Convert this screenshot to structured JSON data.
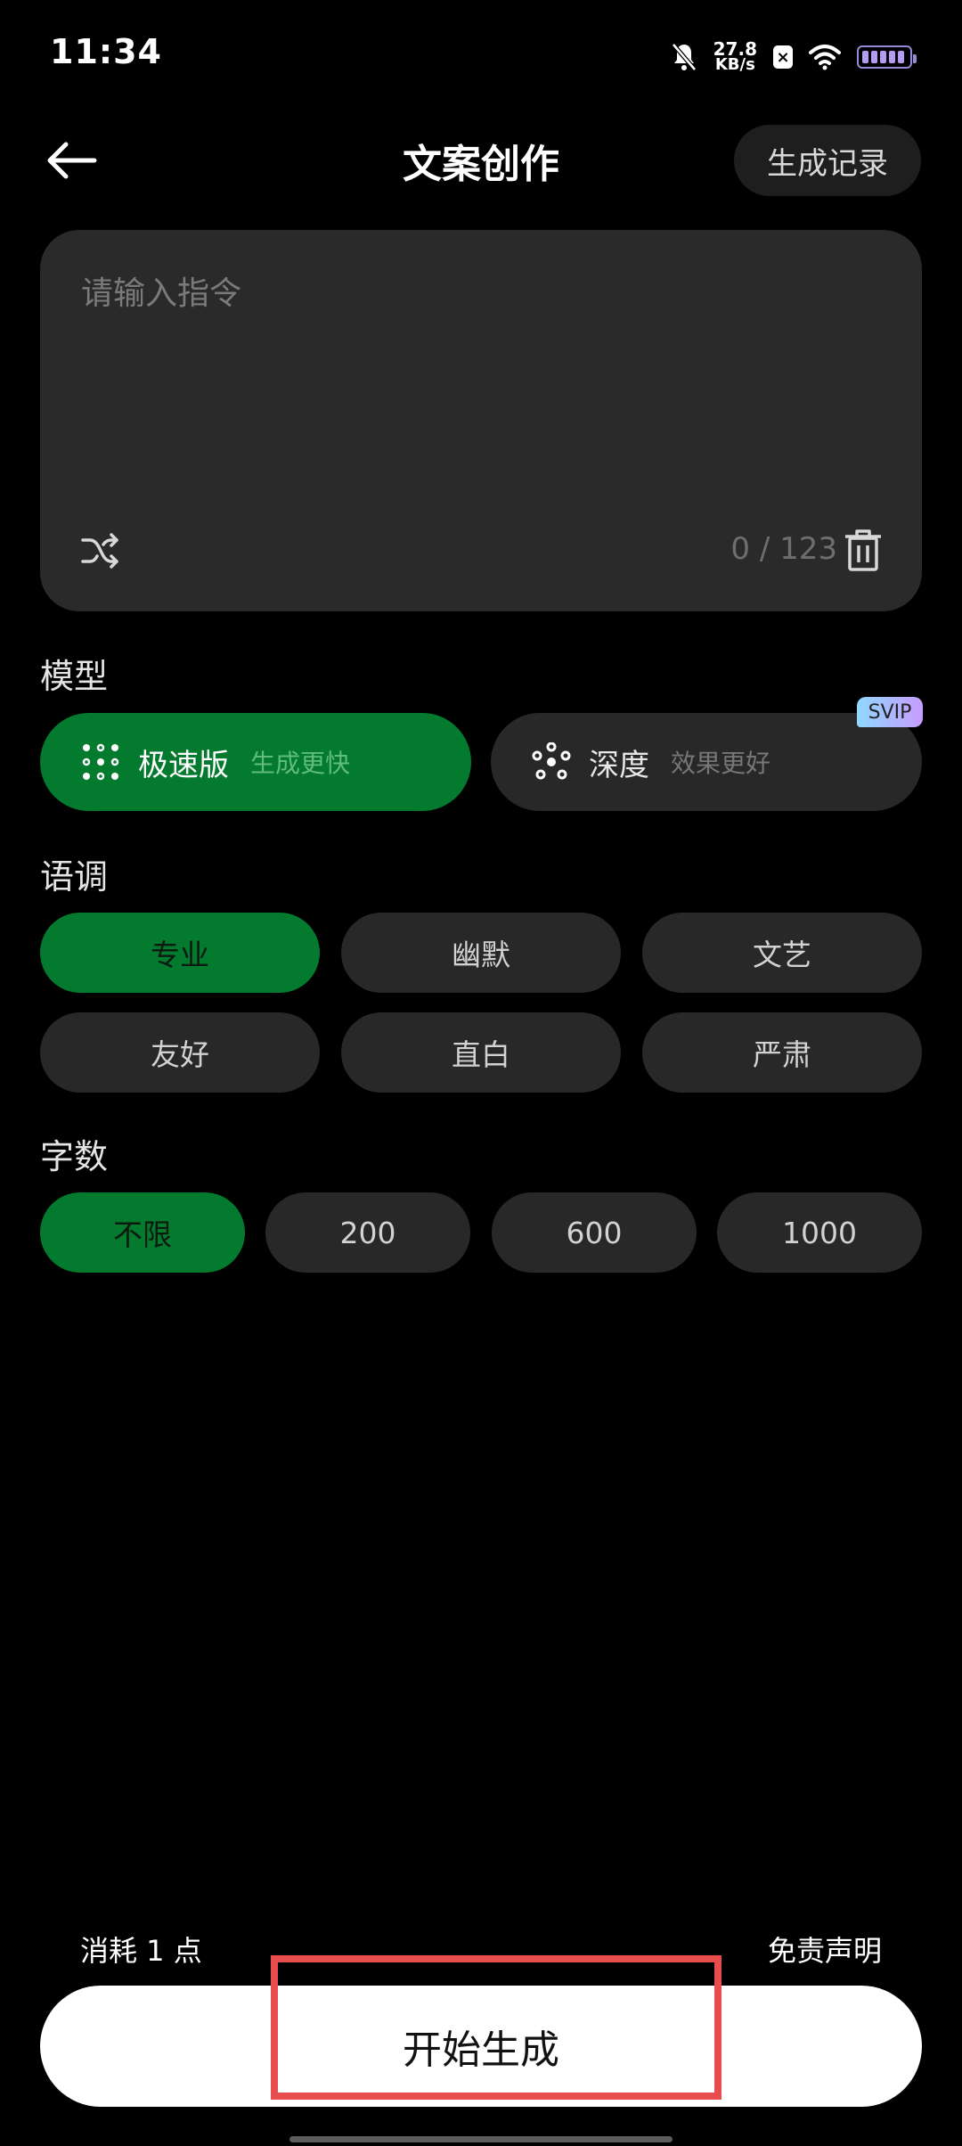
{
  "status_bar": {
    "time": "11:34",
    "net_speed_value": "27.8",
    "net_speed_unit": "KB/s",
    "icons": [
      "bell-muted-icon",
      "sim-x-icon",
      "wifi-icon",
      "battery-icon"
    ]
  },
  "header": {
    "back_icon": "arrow-left-icon",
    "title": "文案创作",
    "history_label": "生成记录"
  },
  "prompt": {
    "placeholder": "请输入指令",
    "value": "",
    "char_count": "0 / 123",
    "shuffle_icon": "shuffle-icon",
    "clear_icon": "trash-icon"
  },
  "model": {
    "label": "模型",
    "options": [
      {
        "name": "极速版",
        "desc": "生成更快",
        "selected": true,
        "icon": "grid-dots-icon"
      },
      {
        "name": "深度",
        "desc": "效果更好",
        "selected": false,
        "icon": "network-icon",
        "badge": "SVIP"
      }
    ]
  },
  "tone": {
    "label": "语调",
    "options": [
      "专业",
      "幽默",
      "文艺",
      "友好",
      "直白",
      "严肃"
    ],
    "selected": "专业"
  },
  "word_count": {
    "label": "字数",
    "options": [
      "不限",
      "200",
      "600",
      "1000"
    ],
    "selected": "不限"
  },
  "footer": {
    "cost": "消耗 1 点",
    "disclaimer": "免责声明",
    "generate_label": "开始生成"
  },
  "colors": {
    "accent_green": "#047a2e",
    "highlight_red": "#e84c4c",
    "card_bg": "#2a2a2a"
  }
}
